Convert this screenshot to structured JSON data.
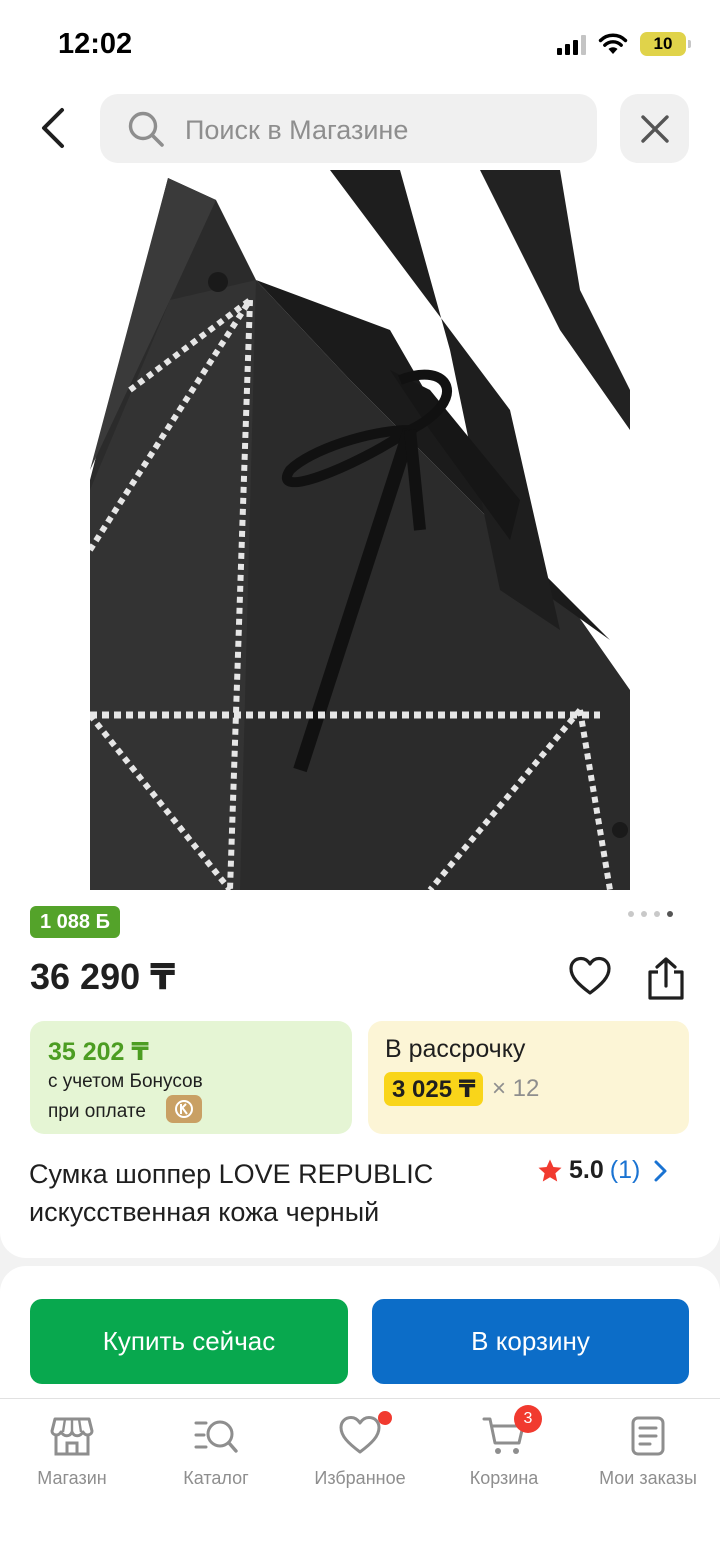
{
  "status_bar": {
    "time": "12:02",
    "battery": "10"
  },
  "search": {
    "placeholder": "Поиск в Магазине"
  },
  "product": {
    "bonus_badge": "1 088 Б",
    "price": "36 290 ₸",
    "title": "Сумка шоппер LOVE REPUBLIC искусственная кожа черный",
    "image_count": 4,
    "image_index": 4,
    "rating": {
      "value": "5.0",
      "count": "(1)"
    }
  },
  "bonus_offer": {
    "price": "35 202 ₸",
    "line1": "с учетом Бонусов",
    "line2": "при оплате"
  },
  "installment": {
    "title": "В рассрочку",
    "amount": "3 025 ₸",
    "multiplier": "× 12"
  },
  "actions": {
    "buy_now": "Купить сейчас",
    "add_to_cart": "В корзину"
  },
  "tabs": [
    {
      "label": "Магазин",
      "icon": "store-icon"
    },
    {
      "label": "Каталог",
      "icon": "catalog-search-icon"
    },
    {
      "label": "Избранное",
      "icon": "heart-icon",
      "dot": true
    },
    {
      "label": "Корзина",
      "icon": "cart-icon",
      "badge": "3"
    },
    {
      "label": "Мои заказы",
      "icon": "orders-icon"
    }
  ],
  "colors": {
    "green": "#08a84e",
    "blue": "#0c6dc8",
    "bonus_green": "#54a32a",
    "installment_yellow": "#f9d51a",
    "badge_red": "#f13a2f"
  }
}
